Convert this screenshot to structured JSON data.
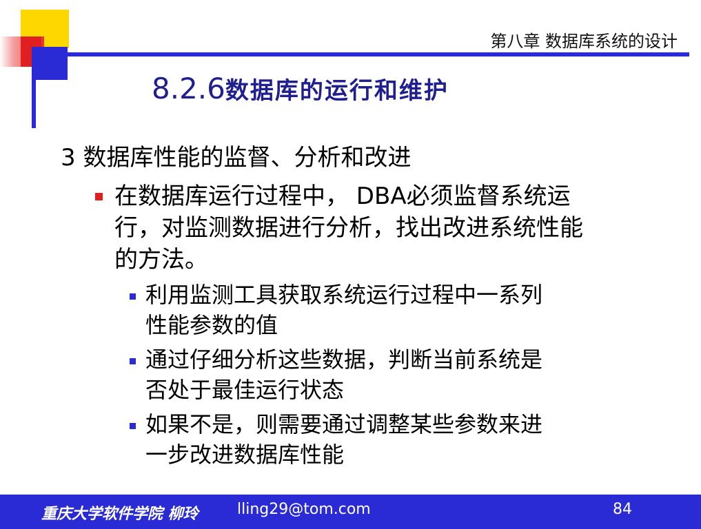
{
  "header": {
    "chapter": "第八章 数据库系统的设计",
    "title_number": "8.2.6",
    "title_text": "数据库的运行和维护"
  },
  "content": {
    "heading": "3 数据库性能的监督、分析和改进",
    "main_point": "在数据库运行过程中， DBA必须监督系统运行，对监测数据进行分析，找出改进系统性能的方法。",
    "sub_points": [
      "利用监测工具获取系统运行过程中一系列性能参数的值",
      "通过仔细分析这些数据，判断当前系统是否处于最佳运行状态",
      "如果不是，则需要通过调整某些参数来进一步改进数据库性能"
    ]
  },
  "footer": {
    "school": "重庆大学软件学院 柳玲",
    "email": "lling29@tom.com",
    "page_number": "84"
  },
  "colors": {
    "accent_blue": "#2b2bd6",
    "title_blue": "#1f1f8f",
    "bullet_red": "#e02020",
    "deco_yellow": "#ffd700"
  }
}
